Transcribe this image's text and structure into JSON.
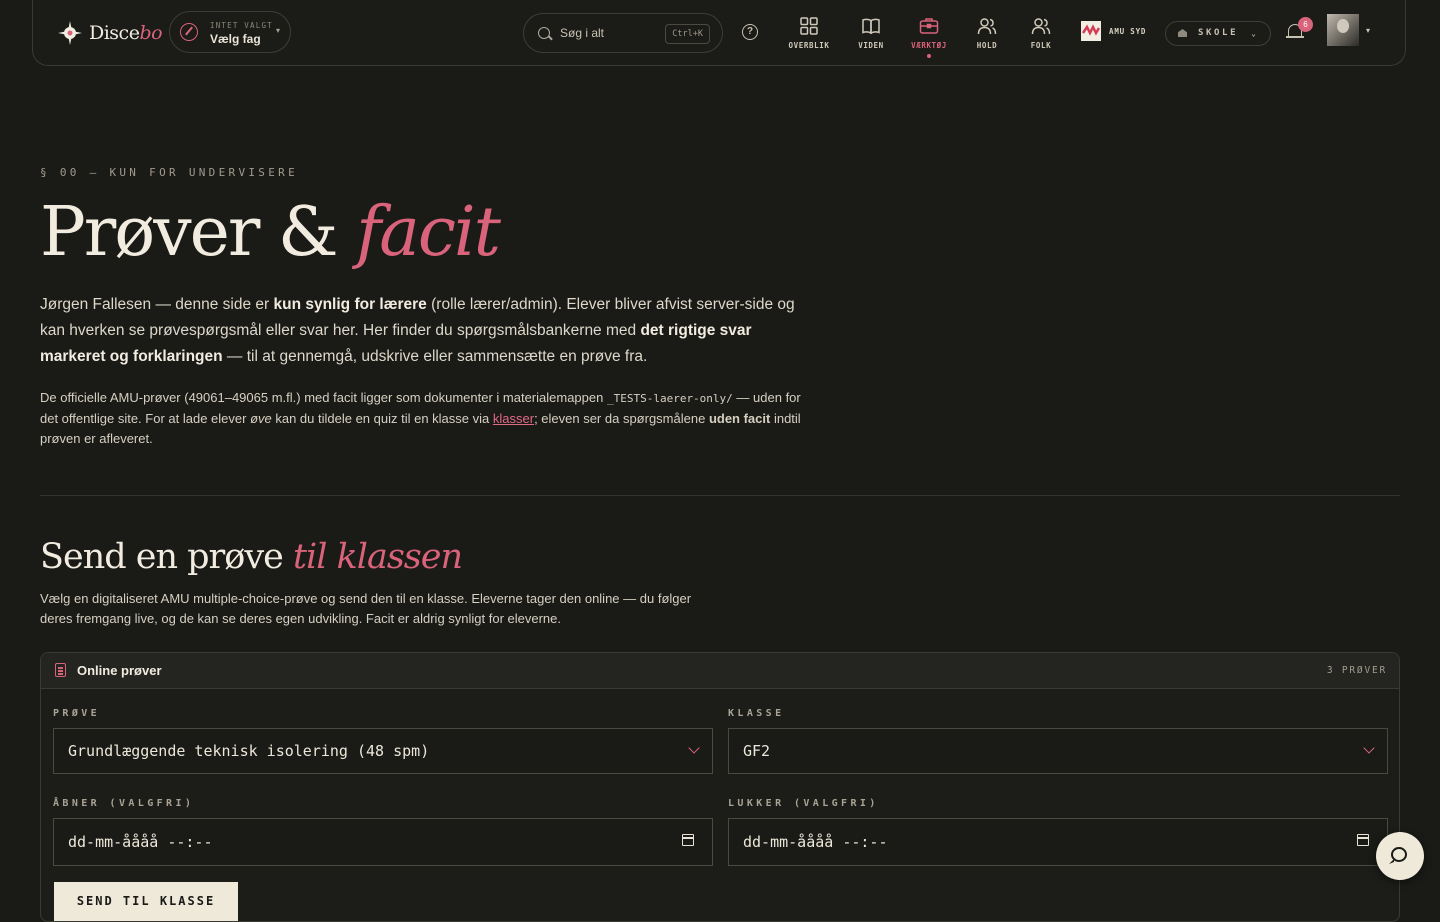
{
  "header": {
    "logo_text": "Disce",
    "logo_text_accent": "bo",
    "subject": {
      "eyebrow": "INTET VALGT",
      "value": "Vælg fag"
    },
    "search": {
      "placeholder": "Søg i alt",
      "shortcut": "Ctrl+K"
    },
    "nav": [
      {
        "label": "OVERBLIK",
        "icon": "grid-icon",
        "active": false
      },
      {
        "label": "VIDEN",
        "icon": "book-icon",
        "active": false
      },
      {
        "label": "VÆRKTØJ",
        "icon": "toolbox-icon",
        "active": true
      },
      {
        "label": "HOLD",
        "icon": "users-icon",
        "active": false
      },
      {
        "label": "FOLK",
        "icon": "people-icon",
        "active": false
      }
    ],
    "school": "AMU SYD",
    "scope_switch": "SKOLE",
    "notifications": "6"
  },
  "hero": {
    "eyebrow": "§ 00 — KUN FOR UNDERVISERE",
    "title": "Prøver & ",
    "title_accent": "facit",
    "lead": {
      "p1": "Jørgen Fallesen — denne side er ",
      "b1": "kun synlig for lærere",
      "p2": " (rolle lærer/admin). Elever bliver afvist server-side og kan hverken se prøvespørgsmål eller svar her. Her finder du spørgsmålsbankerne med ",
      "b2": "det rigtige svar markeret og forklaringen",
      "p3": " — til at gennemgå, udskrive eller sammensætte en prøve fra."
    },
    "note": {
      "p1": "De officielle AMU-prøver (49061–49065 m.fl.) med facit ligger som dokumenter i materialemappen ",
      "code": "_TESTS-laerer-only/",
      "p2": " — uden for det offentlige site. For at lade elever ",
      "em": "øve",
      "p3": " kan du tildele en quiz til en klasse via ",
      "link": "klasser",
      "p4": "; eleven ser da spørgsmålene ",
      "b": "uden facit",
      "p5": " indtil prøven er afleveret."
    }
  },
  "send": {
    "title": "Send en prøve ",
    "title_accent": "til klassen",
    "sub": "Vælg en digitaliseret AMU multiple-choice-prøve og send den til en klasse. Eleverne tager den online — du følger deres fremgang live, og de kan se deres egen udvikling. Facit er aldrig synligt for eleverne.",
    "card": {
      "title": "Online prøver",
      "count": "3 PRØVER",
      "label_prove": "PRØVE",
      "prove_value": "Grundlæggende teknisk isolering (48 spm)",
      "label_klasse": "KLASSE",
      "klasse_value": "GF2",
      "label_open": "ÅBNER (VALGFRI)",
      "open_value": "dd-mm-åååå --:--",
      "label_close": "LUKKER (VALGFRI)",
      "close_value": "dd-mm-åååå --:--",
      "send_label": "SEND TIL KLASSE"
    }
  },
  "colors": {
    "accent": "#d9637a",
    "background": "#1a1a17",
    "text": "#e7e2d3"
  }
}
